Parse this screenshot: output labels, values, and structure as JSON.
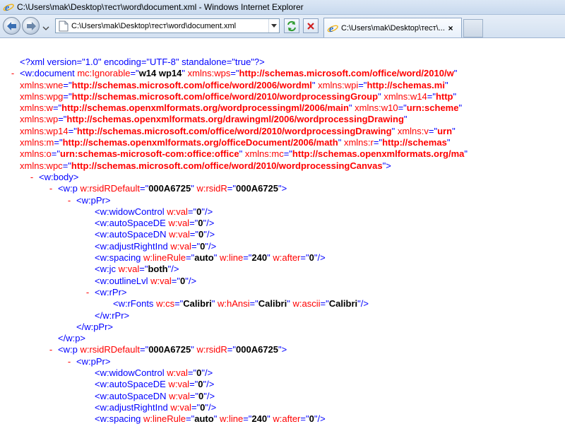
{
  "window": {
    "title": "C:\\Users\\mak\\Desktop\\тест\\word\\document.xml - Windows Internet Explorer",
    "address": "C:\\Users\\mak\\Desktop\\тест\\word\\document.xml",
    "tab_title": "C:\\Users\\mak\\Desktop\\тест\\...",
    "icons": {
      "app": "ie-logo-icon",
      "back": "back-arrow-icon",
      "forward": "forward-arrow-icon",
      "refresh": "refresh-icon",
      "stop": "stop-icon",
      "page": "page-icon",
      "close": "close-icon"
    },
    "colors": {
      "markup": "#0000ff",
      "attr_name": "#ff0000",
      "attr_value": "#000000",
      "toggle": "#ff0000"
    }
  },
  "xml": {
    "declaration": "<?xml version=\"1.0\" encoding=\"UTF-8\" standalone=\"true\"?>",
    "lines": [
      {
        "indent": 0,
        "m": "-",
        "open": "<w:document",
        "attrs": [
          [
            "mc:Ignorable",
            "w14 wp14"
          ],
          [
            "xmlns:wps",
            "http://schemas.microsoft.com/office/word/2010/w"
          ]
        ],
        "close": ""
      },
      {
        "indent": 1,
        "attrs": [
          [
            "xmlns:wne",
            "http://schemas.microsoft.com/office/word/2006/wordml"
          ],
          [
            "xmlns:wpi",
            "http://schemas.mi"
          ]
        ],
        "close": ""
      },
      {
        "indent": 1,
        "attrs": [
          [
            "xmlns:wpg",
            "http://schemas.microsoft.com/office/word/2010/wordprocessingGroup"
          ],
          [
            "xmlns:w14",
            "http"
          ]
        ],
        "close": ""
      },
      {
        "indent": 1,
        "attrs": [
          [
            "xmlns:w",
            "http://schemas.openxmlformats.org/wordprocessingml/2006/main"
          ],
          [
            "xmlns:w10",
            "urn:scheme"
          ]
        ],
        "close": ""
      },
      {
        "indent": 1,
        "attrs": [
          [
            "xmlns:wp",
            "http://schemas.openxmlformats.org/drawingml/2006/wordprocessingDrawing"
          ]
        ],
        "close": ""
      },
      {
        "indent": 1,
        "attrs": [
          [
            "xmlns:wp14",
            "http://schemas.microsoft.com/office/word/2010/wordprocessingDrawing"
          ],
          [
            "xmlns:v",
            "urn"
          ]
        ],
        "close": ""
      },
      {
        "indent": 1,
        "attrs": [
          [
            "xmlns:m",
            "http://schemas.openxmlformats.org/officeDocument/2006/math"
          ],
          [
            "xmlns:r",
            "http://schemas"
          ]
        ],
        "close": ""
      },
      {
        "indent": 1,
        "attrs": [
          [
            "xmlns:o",
            "urn:schemas-microsoft-com:office:office"
          ],
          [
            "xmlns:mc",
            "http://schemas.openxmlformats.org/ma"
          ]
        ],
        "close": ""
      },
      {
        "indent": 1,
        "attrs": [
          [
            "xmlns:wpc",
            "http://schemas.microsoft.com/office/word/2010/wordprocessingCanvas"
          ]
        ],
        "close": ">"
      },
      {
        "indent": 1,
        "m": "-",
        "open": "<w:body>",
        "attrs": [],
        "close": ""
      },
      {
        "indent": 2,
        "m": "-",
        "open": "<w:p",
        "attrs": [
          [
            "w:rsidRDefault",
            "000A6725"
          ],
          [
            "w:rsidR",
            "000A6725"
          ]
        ],
        "close": ">"
      },
      {
        "indent": 3,
        "m": "-",
        "open": "<w:pPr>",
        "attrs": [],
        "close": ""
      },
      {
        "indent": 4,
        "open": "<w:widowControl",
        "attrs": [
          [
            "w:val",
            "0"
          ]
        ],
        "close": "/>"
      },
      {
        "indent": 4,
        "open": "<w:autoSpaceDE",
        "attrs": [
          [
            "w:val",
            "0"
          ]
        ],
        "close": "/>"
      },
      {
        "indent": 4,
        "open": "<w:autoSpaceDN",
        "attrs": [
          [
            "w:val",
            "0"
          ]
        ],
        "close": "/>"
      },
      {
        "indent": 4,
        "open": "<w:adjustRightInd",
        "attrs": [
          [
            "w:val",
            "0"
          ]
        ],
        "close": "/>"
      },
      {
        "indent": 4,
        "open": "<w:spacing",
        "attrs": [
          [
            "w:lineRule",
            "auto"
          ],
          [
            "w:line",
            "240"
          ],
          [
            "w:after",
            "0"
          ]
        ],
        "close": "/>"
      },
      {
        "indent": 4,
        "open": "<w:jc",
        "attrs": [
          [
            "w:val",
            "both"
          ]
        ],
        "close": "/>"
      },
      {
        "indent": 4,
        "open": "<w:outlineLvl",
        "attrs": [
          [
            "w:val",
            "0"
          ]
        ],
        "close": "/>"
      },
      {
        "indent": 4,
        "m": "-",
        "open": "<w:rPr>",
        "attrs": [],
        "close": "",
        "mshift": true
      },
      {
        "indent": 5,
        "open": "<w:rFonts",
        "attrs": [
          [
            "w:cs",
            "Calibri"
          ],
          [
            "w:hAnsi",
            "Calibri"
          ],
          [
            "w:ascii",
            "Calibri"
          ]
        ],
        "close": "/>"
      },
      {
        "indent": 4,
        "open": "</w:rPr>",
        "attrs": [],
        "close": ""
      },
      {
        "indent": 3,
        "open": "</w:pPr>",
        "attrs": [],
        "close": ""
      },
      {
        "indent": 2,
        "open": "</w:p>",
        "attrs": [],
        "close": ""
      },
      {
        "indent": 2,
        "m": "-",
        "open": "<w:p",
        "attrs": [
          [
            "w:rsidRDefault",
            "000A6725"
          ],
          [
            "w:rsidR",
            "000A6725"
          ]
        ],
        "close": ">"
      },
      {
        "indent": 3,
        "m": "-",
        "open": "<w:pPr>",
        "attrs": [],
        "close": ""
      },
      {
        "indent": 4,
        "open": "<w:widowControl",
        "attrs": [
          [
            "w:val",
            "0"
          ]
        ],
        "close": "/>"
      },
      {
        "indent": 4,
        "open": "<w:autoSpaceDE",
        "attrs": [
          [
            "w:val",
            "0"
          ]
        ],
        "close": "/>"
      },
      {
        "indent": 4,
        "open": "<w:autoSpaceDN",
        "attrs": [
          [
            "w:val",
            "0"
          ]
        ],
        "close": "/>"
      },
      {
        "indent": 4,
        "open": "<w:adjustRightInd",
        "attrs": [
          [
            "w:val",
            "0"
          ]
        ],
        "close": "/>"
      },
      {
        "indent": 4,
        "open": "<w:spacing",
        "attrs": [
          [
            "w:lineRule",
            "auto"
          ],
          [
            "w:line",
            "240"
          ],
          [
            "w:after",
            "0"
          ]
        ],
        "close": "/>"
      }
    ]
  }
}
